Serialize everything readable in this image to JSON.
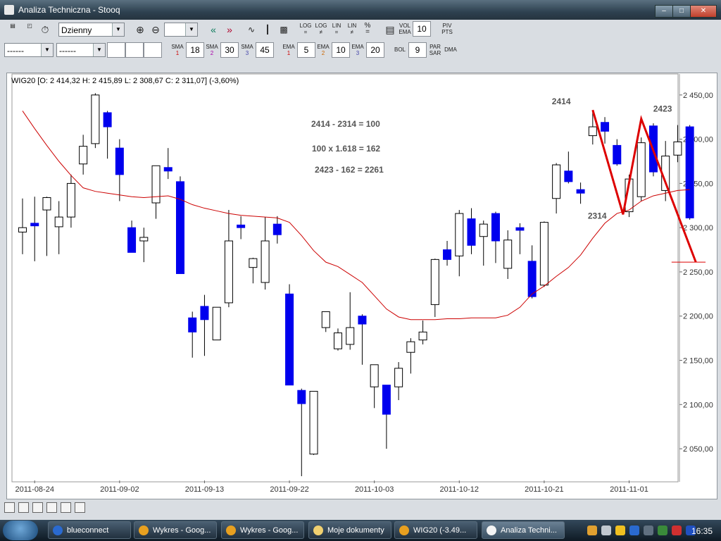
{
  "window": {
    "title": "Analiza Techniczna - Stooq"
  },
  "toolbar1": {
    "interval_value": "Dzienny",
    "log_labels": [
      "LOG",
      "LOG",
      "LIN",
      "LIN",
      "%"
    ],
    "vol_ema_label_top": "VOL",
    "vol_ema_label_bottom": "EMA",
    "vol_ema_value": "10",
    "piv_top": "PIV",
    "piv_bottom": "PTS"
  },
  "toolbar2": {
    "select1_value": "------",
    "select2_value": "------",
    "sma": [
      {
        "label": "SMA",
        "n": "1",
        "value": "18"
      },
      {
        "label": "SMA",
        "n": "2",
        "value": "30"
      },
      {
        "label": "SMA",
        "n": "3",
        "value": "45"
      }
    ],
    "ema": [
      {
        "label": "EMA",
        "n": "1",
        "value": "5"
      },
      {
        "label": "EMA",
        "n": "2",
        "value": "10"
      },
      {
        "label": "EMA",
        "n": "3",
        "value": "20"
      }
    ],
    "bol_label": "BOL",
    "bol_value": "9",
    "par_top": "PAR",
    "par_bottom": "SAR",
    "dma_label": "DMA"
  },
  "colors": {
    "bull": "#ffffff",
    "bear": "#0000ee",
    "ma_line": "#cc0000",
    "annotation": "#dd0000",
    "axis_text": "#333333"
  },
  "chart_data": {
    "type": "candlestick",
    "title": "WIG20 [O: 2 414,32  H: 2 415,89  L: 2 308,67  C: 2 311,07] (-3,60%)",
    "ylim": [
      2015,
      2465
    ],
    "y_ticks": [
      2050,
      2100,
      2150,
      2200,
      2250,
      2300,
      2350,
      2400,
      2450
    ],
    "y_tick_labels": [
      "2 050,00",
      "2 100,00",
      "2 150,00",
      "2 200,00",
      "2 250,00",
      "2 300,00",
      "2 350,00",
      "2 400,00",
      "2 450,00"
    ],
    "x_tick_labels": [
      {
        "label": "2011-08-24",
        "index": 1
      },
      {
        "label": "2011-09-02",
        "index": 8
      },
      {
        "label": "2011-09-13",
        "index": 15
      },
      {
        "label": "2011-09-22",
        "index": 22
      },
      {
        "label": "2011-10-03",
        "index": 29
      },
      {
        "label": "2011-10-12",
        "index": 36
      },
      {
        "label": "2011-10-21",
        "index": 43
      },
      {
        "label": "2011-11-01",
        "index": 50
      }
    ],
    "candles": [
      {
        "o": 2295,
        "h": 2333,
        "l": 2270,
        "c": 2300
      },
      {
        "o": 2305,
        "h": 2335,
        "l": 2262,
        "c": 2302
      },
      {
        "o": 2320,
        "h": 2335,
        "l": 2268,
        "c": 2334
      },
      {
        "o": 2301,
        "h": 2330,
        "l": 2270,
        "c": 2312
      },
      {
        "o": 2312,
        "h": 2360,
        "l": 2300,
        "c": 2350
      },
      {
        "o": 2372,
        "h": 2405,
        "l": 2360,
        "c": 2392
      },
      {
        "o": 2395,
        "h": 2452,
        "l": 2390,
        "c": 2450
      },
      {
        "o": 2430,
        "h": 2432,
        "l": 2378,
        "c": 2414
      },
      {
        "o": 2390,
        "h": 2400,
        "l": 2330,
        "c": 2360
      },
      {
        "o": 2300,
        "h": 2308,
        "l": 2272,
        "c": 2272
      },
      {
        "o": 2285,
        "h": 2300,
        "l": 2261,
        "c": 2289
      },
      {
        "o": 2328,
        "h": 2370,
        "l": 2310,
        "c": 2370
      },
      {
        "o": 2368,
        "h": 2390,
        "l": 2355,
        "c": 2364
      },
      {
        "o": 2352,
        "h": 2358,
        "l": 2248,
        "c": 2248
      },
      {
        "o": 2198,
        "h": 2205,
        "l": 2153,
        "c": 2182
      },
      {
        "o": 2211,
        "h": 2224,
        "l": 2155,
        "c": 2196
      },
      {
        "o": 2173,
        "h": 2210,
        "l": 2173,
        "c": 2210
      },
      {
        "o": 2215,
        "h": 2320,
        "l": 2210,
        "c": 2285
      },
      {
        "o": 2303,
        "h": 2313,
        "l": 2287,
        "c": 2300
      },
      {
        "o": 2255,
        "h": 2266,
        "l": 2237,
        "c": 2265
      },
      {
        "o": 2238,
        "h": 2312,
        "l": 2230,
        "c": 2285
      },
      {
        "o": 2304,
        "h": 2313,
        "l": 2282,
        "c": 2292
      },
      {
        "o": 2225,
        "h": 2236,
        "l": 2122,
        "c": 2122
      },
      {
        "o": 2116,
        "h": 2118,
        "l": 2019,
        "c": 2101
      },
      {
        "o": 2044,
        "h": 2115,
        "l": 2043,
        "c": 2115
      },
      {
        "o": 2187,
        "h": 2205,
        "l": 2182,
        "c": 2205
      },
      {
        "o": 2163,
        "h": 2186,
        "l": 2161,
        "c": 2181
      },
      {
        "o": 2168,
        "h": 2227,
        "l": 2162,
        "c": 2187
      },
      {
        "o": 2200,
        "h": 2202,
        "l": 2145,
        "c": 2191
      },
      {
        "o": 2120,
        "h": 2145,
        "l": 2096,
        "c": 2145
      },
      {
        "o": 2122,
        "h": 2122,
        "l": 2050,
        "c": 2089
      },
      {
        "o": 2120,
        "h": 2148,
        "l": 2105,
        "c": 2141
      },
      {
        "o": 2159,
        "h": 2175,
        "l": 2135,
        "c": 2171
      },
      {
        "o": 2173,
        "h": 2195,
        "l": 2168,
        "c": 2182
      },
      {
        "o": 2213,
        "h": 2265,
        "l": 2199,
        "c": 2264
      },
      {
        "o": 2275,
        "h": 2285,
        "l": 2257,
        "c": 2264
      },
      {
        "o": 2268,
        "h": 2320,
        "l": 2245,
        "c": 2316
      },
      {
        "o": 2310,
        "h": 2322,
        "l": 2270,
        "c": 2280
      },
      {
        "o": 2290,
        "h": 2308,
        "l": 2257,
        "c": 2304
      },
      {
        "o": 2316,
        "h": 2318,
        "l": 2260,
        "c": 2285
      },
      {
        "o": 2254,
        "h": 2297,
        "l": 2242,
        "c": 2286
      },
      {
        "o": 2300,
        "h": 2305,
        "l": 2270,
        "c": 2297
      },
      {
        "o": 2262,
        "h": 2280,
        "l": 2220,
        "c": 2222
      },
      {
        "o": 2235,
        "h": 2307,
        "l": 2233,
        "c": 2306
      },
      {
        "o": 2333,
        "h": 2373,
        "l": 2316,
        "c": 2371
      },
      {
        "o": 2364,
        "h": 2386,
        "l": 2350,
        "c": 2352
      },
      {
        "o": 2343,
        "h": 2351,
        "l": 2327,
        "c": 2339
      },
      {
        "o": 2404,
        "h": 2432,
        "l": 2394,
        "c": 2414
      },
      {
        "o": 2419,
        "h": 2425,
        "l": 2395,
        "c": 2409
      },
      {
        "o": 2393,
        "h": 2400,
        "l": 2370,
        "c": 2372
      },
      {
        "o": 2318,
        "h": 2360,
        "l": 2312,
        "c": 2355
      },
      {
        "o": 2335,
        "h": 2402,
        "l": 2330,
        "c": 2396
      },
      {
        "o": 2415,
        "h": 2418,
        "l": 2358,
        "c": 2363
      },
      {
        "o": 2342,
        "h": 2398,
        "l": 2330,
        "c": 2381
      },
      {
        "o": 2382,
        "h": 2416,
        "l": 2374,
        "c": 2397
      },
      {
        "o": 2414,
        "h": 2416,
        "l": 2309,
        "c": 2311
      }
    ],
    "ma_series": [
      2432,
      2412,
      2393,
      2375,
      2359,
      2345,
      2341,
      2339,
      2337,
      2335,
      2334,
      2335,
      2336,
      2332,
      2326,
      2322,
      2319,
      2316,
      2314,
      2313,
      2312,
      2311,
      2306,
      2291,
      2274,
      2261,
      2256,
      2247,
      2238,
      2223,
      2208,
      2199,
      2196,
      2196,
      2196,
      2197,
      2197,
      2198,
      2198,
      2198,
      2201,
      2210,
      2225,
      2234,
      2245,
      2255,
      2269,
      2288,
      2305,
      2316,
      2320,
      2330,
      2336,
      2339,
      2342,
      2343
    ],
    "annotations": {
      "texts": [
        "2414 - 2314 = 100",
        "100 x 1.618 = 162",
        "2423 - 162 = 2261"
      ],
      "points": [
        {
          "label": "2414",
          "index": 47,
          "value": 2433
        },
        {
          "label": "2314",
          "index": 49.5,
          "value": 2315
        },
        {
          "label": "2423",
          "index": 51,
          "value": 2423
        }
      ],
      "zigzag": [
        {
          "index": 47,
          "value": 2433
        },
        {
          "index": 49.5,
          "value": 2315
        },
        {
          "index": 51,
          "value": 2423
        },
        {
          "index": 55.5,
          "value": 2261
        }
      ],
      "target": {
        "value": 2261,
        "from_index": 53.5,
        "to_index": 56.3
      }
    }
  },
  "taskbar": {
    "items": [
      {
        "label": "blueconnect",
        "color": "#2a6ad0"
      },
      {
        "label": "Wykres - Goog...",
        "color": "#e8a020"
      },
      {
        "label": "Wykres - Goog...",
        "color": "#e8a020"
      },
      {
        "label": "Moje dokumenty",
        "color": "#f0d070"
      },
      {
        "label": "WIG20 (-3.49...",
        "color": "#e8a020"
      },
      {
        "label": "Analiza Techni...",
        "color": "#f4f4f4"
      }
    ],
    "clock": "16:35"
  }
}
